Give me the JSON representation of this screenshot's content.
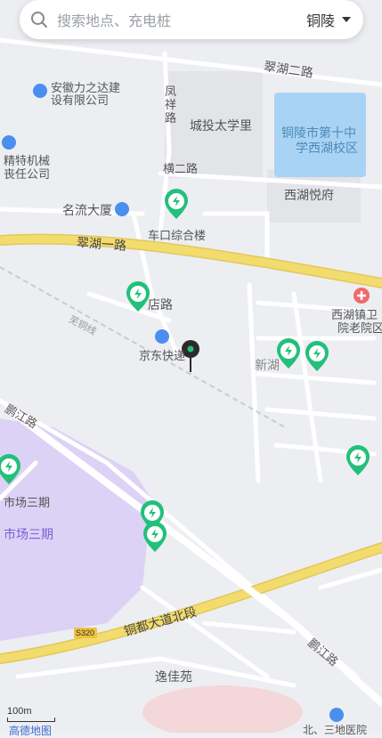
{
  "search": {
    "placeholder": "搜索地点、充电桩",
    "city": "铜陵"
  },
  "labels": {
    "anhui_lizhida": "安徽力之达建",
    "anhui_lizhida2": "设有限公司",
    "fengxiang_road": "凤祥路",
    "chengtou_taixueli": "城投太学里",
    "school": "铜陵市第十中",
    "school2": "学西湖校区",
    "jingte1": "精特机械",
    "jingte2": "丧任公司",
    "henger_road": "横二路",
    "xihu_yuefu": "西湖悦府",
    "mingliu": "名流大厦",
    "chekou": "车口综合楼",
    "cuihu_yilu_top": "翠湖二路",
    "cuihu_yilu": "翠湖一路",
    "dian_road": "店路",
    "xihu_hospital": "西湖镇卫",
    "xihu_hospital2": "院老院区",
    "jd_express": "京东快递",
    "xinhu": "新湖",
    "railway": "芜铜线",
    "pengjiang_road": "鹏江路",
    "market3": "市场三期",
    "market3_area": "市场三期",
    "tongdu_road": "铜都大道北段",
    "s320": "S320",
    "pengjiang_road2": "鹏江路",
    "yijiayuan": "逸佳苑",
    "bottom_right": "北、三地医院",
    "scale": "100m",
    "logo": "高德地图"
  },
  "colors": {
    "charger": "#22c07a",
    "major_road": "#f3dc6e",
    "water": "#a9d3f5",
    "purple_area": "#dcd2f5",
    "hospital": "#f06a6a",
    "poi_blue": "#4a8ff0"
  }
}
